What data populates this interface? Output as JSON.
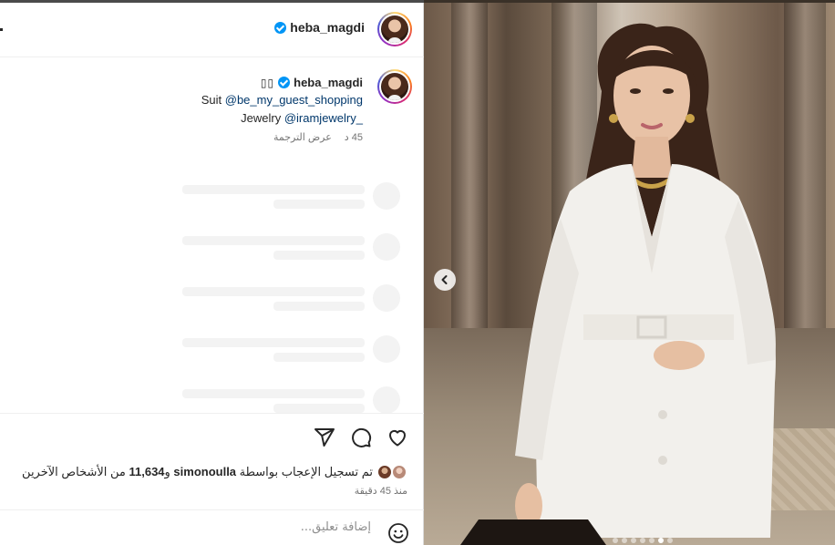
{
  "post": {
    "username": "heba_magdi",
    "caption": {
      "emoji_boxes": "▯▯",
      "username": "heba_magdi",
      "line2_label": "Suit ",
      "line2_mention": "@be_my_guest_shopping",
      "line3_label": "Jewelry ",
      "line3_mention": "@iramjewelry_",
      "time": "45 د",
      "translate": "عرض الترجمة"
    },
    "likes": {
      "text_prefix": "تم تسجيل الإعجاب بواسطة ",
      "liker": "simonoulla",
      "text_middle": " و",
      "count": "11,634",
      "text_suffix": " من الأشخاص الآخرين"
    },
    "time_ago": "منذ 45 دقيقة",
    "comment_placeholder": "إضافة تعليق..."
  },
  "carousel": {
    "total": 7,
    "active_index": 5
  },
  "icons": [
    "verified-badge-icon",
    "heart-icon",
    "comment-icon",
    "share-icon",
    "emoji-icon",
    "chevron-left-icon"
  ],
  "colors": {
    "verified": "#0095f6",
    "mention": "#00376b",
    "muted": "#737373"
  }
}
